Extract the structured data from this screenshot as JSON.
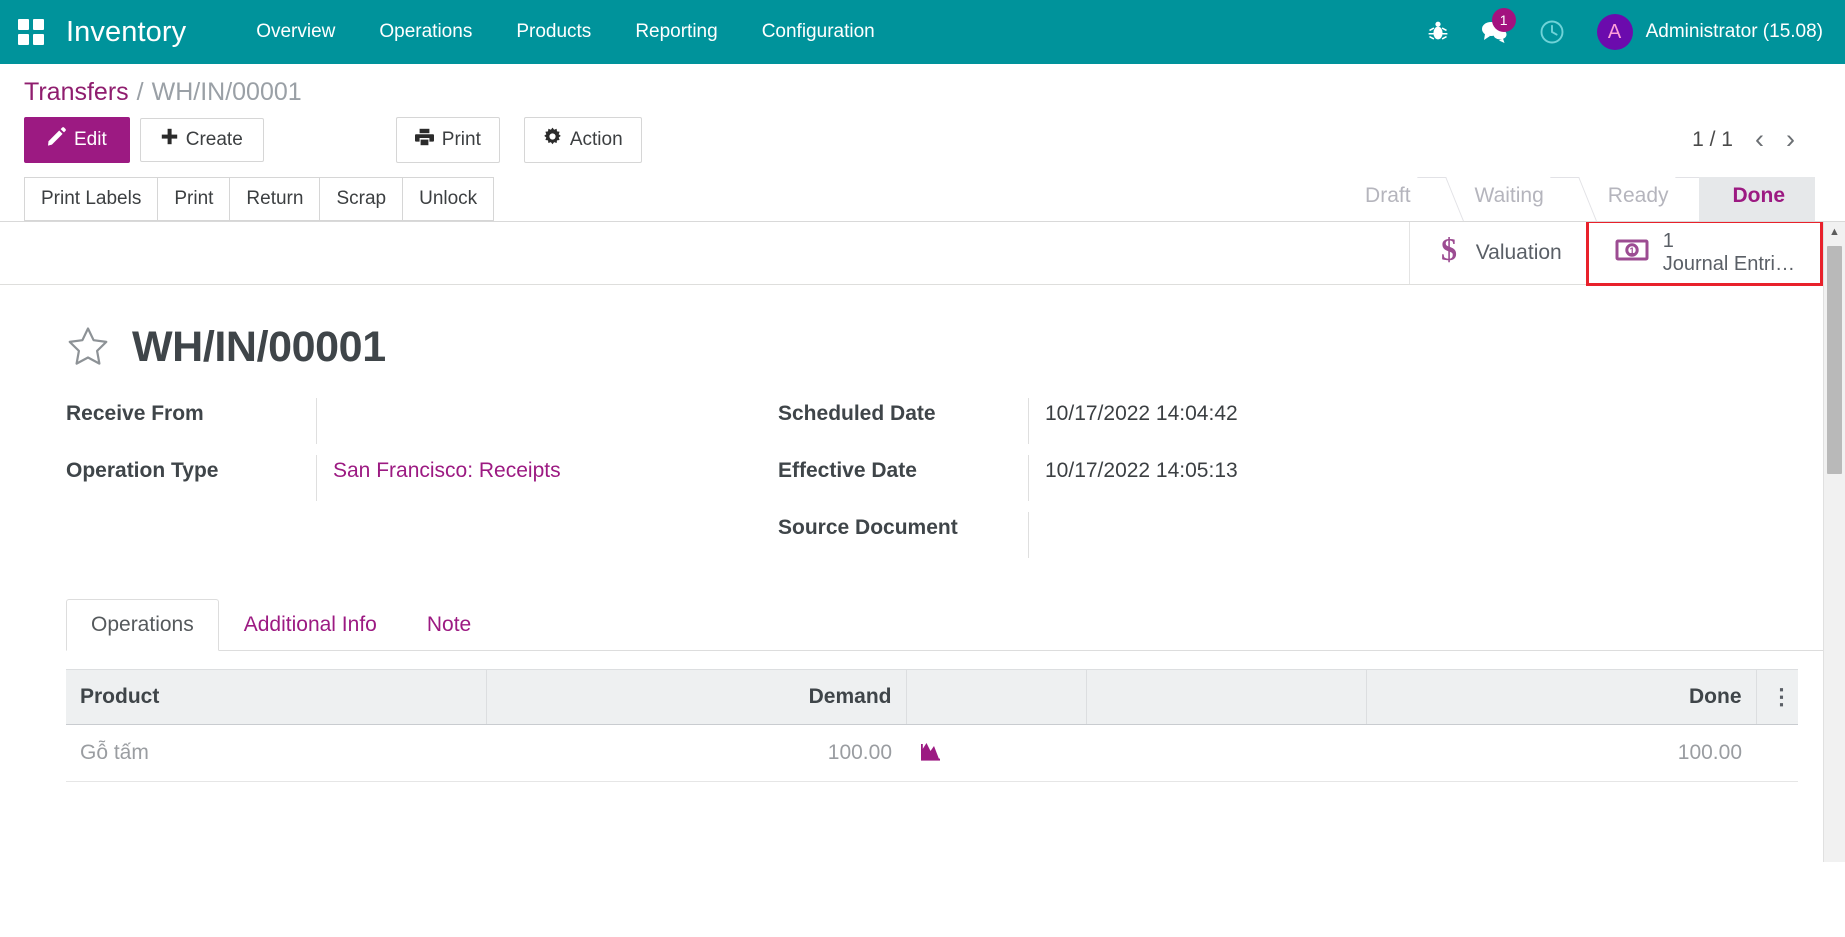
{
  "navbar": {
    "apps_icon": "apps-grid-icon",
    "brand": "Inventory",
    "menu": [
      {
        "label": "Overview"
      },
      {
        "label": "Operations"
      },
      {
        "label": "Products"
      },
      {
        "label": "Reporting"
      },
      {
        "label": "Configuration"
      }
    ],
    "icons": {
      "debug": "bug-icon",
      "messages": "messages-icon",
      "messages_badge": "1",
      "activities": "clock-icon"
    },
    "user": {
      "avatar_initial": "A",
      "name": "Administrator (15.08)"
    },
    "colors": {
      "background": "#00939b",
      "badge": "#a3127f",
      "avatar": "#6b0bad"
    }
  },
  "breadcrumb": {
    "root": "Transfers",
    "separator": "/",
    "current": "WH/IN/00001"
  },
  "control_panel": {
    "edit_label": "Edit",
    "create_label": "Create",
    "print_label": "Print",
    "action_label": "Action",
    "pager_count": "1 / 1",
    "pager_prev": "‹",
    "pager_next": "›"
  },
  "statusbar": {
    "buttons": [
      {
        "label": "Print Labels"
      },
      {
        "label": "Print"
      },
      {
        "label": "Return"
      },
      {
        "label": "Scrap"
      },
      {
        "label": "Unlock"
      }
    ],
    "stages": [
      {
        "label": "Draft",
        "active": false
      },
      {
        "label": "Waiting",
        "active": false
      },
      {
        "label": "Ready",
        "active": false
      },
      {
        "label": "Done",
        "active": true
      }
    ],
    "active_color": "#9c1a82"
  },
  "smart_buttons": [
    {
      "name": "valuation",
      "icon": "dollar-icon",
      "label": "Valuation",
      "value": "",
      "highlighted": false
    },
    {
      "name": "journal-entries",
      "icon": "money-bill-icon",
      "value": "1",
      "label": "Journal Entri…",
      "highlighted": true,
      "highlight_color": "#e8212b"
    }
  ],
  "record": {
    "favorite_icon": "star-icon",
    "title": "WH/IN/00001"
  },
  "fields": {
    "left": [
      {
        "label": "Receive From",
        "value": "",
        "is_link": false
      },
      {
        "label": "Operation Type",
        "value": "San Francisco: Receipts",
        "is_link": true
      }
    ],
    "right": [
      {
        "label": "Scheduled Date",
        "value": "10/17/2022 14:04:42",
        "is_link": false
      },
      {
        "label": "Effective Date",
        "value": "10/17/2022 14:05:13",
        "is_link": false
      },
      {
        "label": "Source Document",
        "value": "",
        "is_link": false
      }
    ]
  },
  "notebook": {
    "tabs": [
      {
        "label": "Operations",
        "active": true
      },
      {
        "label": "Additional Info",
        "active": false
      },
      {
        "label": "Note",
        "active": false
      }
    ]
  },
  "lines_table": {
    "columns": [
      "Product",
      "",
      "Demand",
      "",
      "",
      "Done"
    ],
    "options_icon": "vertical-dots-icon",
    "rows": [
      {
        "product": "Gỗ tấm",
        "demand": "100.00",
        "forecast_icon": "area-chart-icon",
        "done": "100.00"
      }
    ]
  },
  "scrollbar": {
    "up_arrow": "▲",
    "down_arrow": "▼"
  }
}
